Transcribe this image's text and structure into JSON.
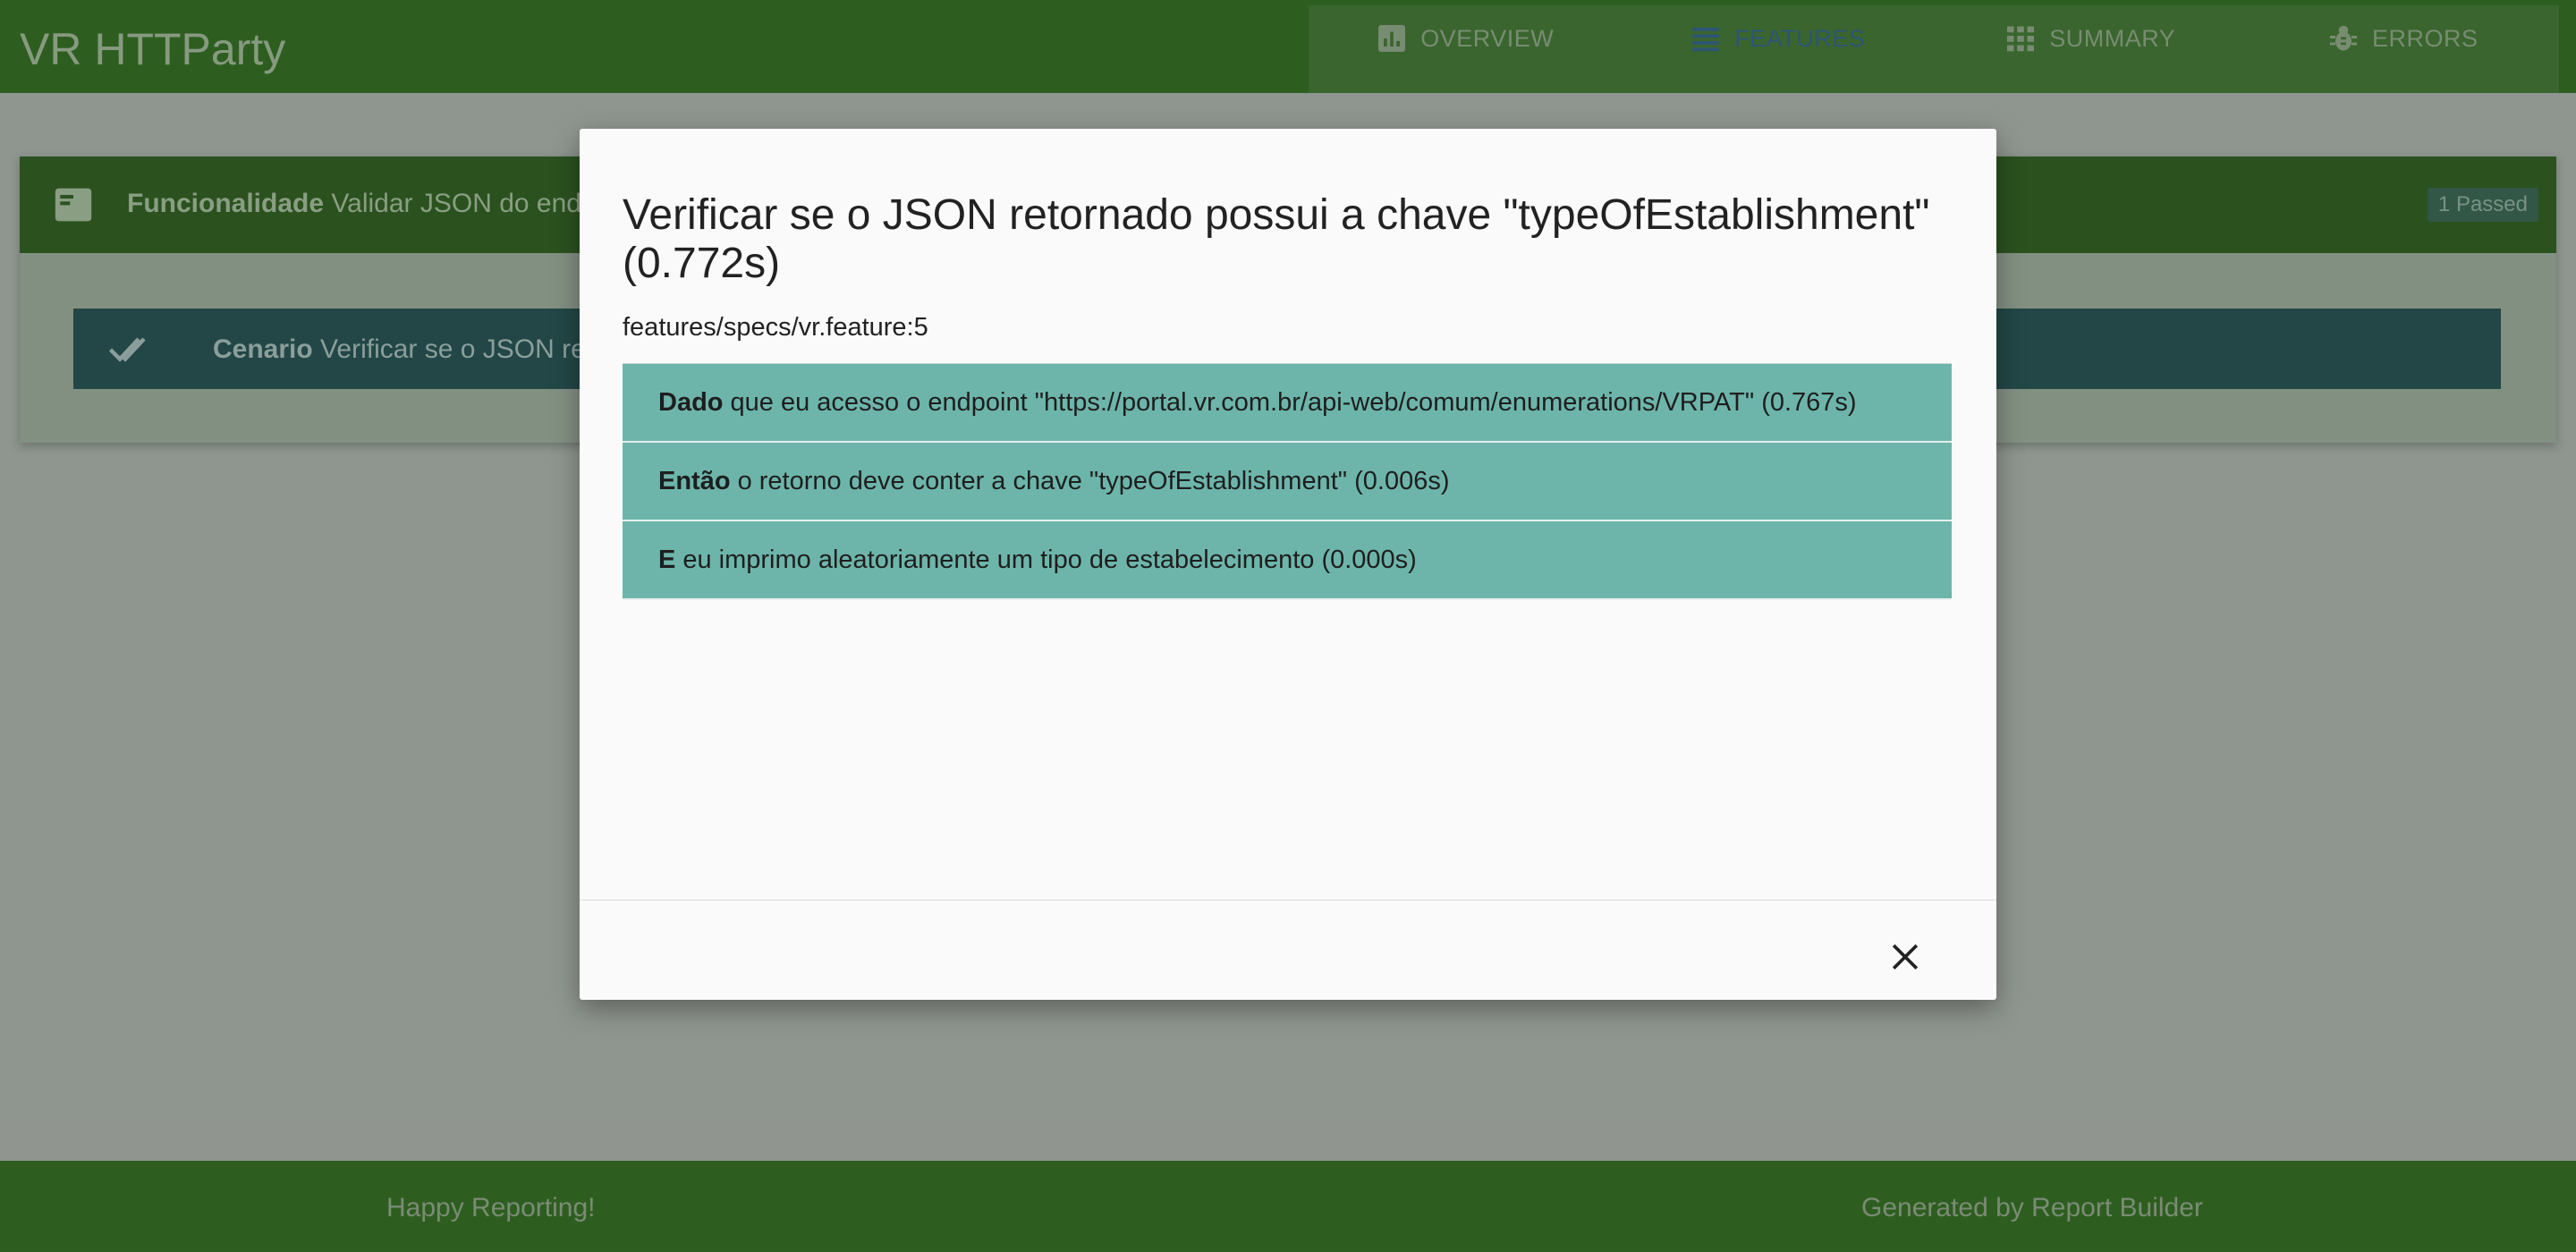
{
  "app": {
    "title": "VR HTTParty"
  },
  "nav": {
    "items": [
      {
        "label": "OVERVIEW",
        "icon": "bar-chart-icon",
        "active": false
      },
      {
        "label": "FEATURES",
        "icon": "list-icon",
        "active": true
      },
      {
        "label": "SUMMARY",
        "icon": "grid-icon",
        "active": false
      },
      {
        "label": "ERRORS",
        "icon": "bug-icon",
        "active": false
      }
    ]
  },
  "feature": {
    "keyword": "Funcionalidade",
    "name": "Validar JSON do endp",
    "badge": "1 Passed"
  },
  "scenario": {
    "keyword": "Cenario",
    "name": "Verificar se o JSON retorna"
  },
  "modal": {
    "title": "Verificar se o JSON retornado possui a chave \"typeOfEstablishment\" (0.772s)",
    "subtitle": "features/specs/vr.feature:5",
    "steps": [
      {
        "keyword": "Dado",
        "text": "que eu acesso o endpoint \"https://portal.vr.com.br/api-web/comum/enumerations/VRPAT\" (0.767s)"
      },
      {
        "keyword": "Então",
        "text": "o retorno deve conter a chave \"typeOfEstablishment\" (0.006s)"
      },
      {
        "keyword": "E",
        "text": "eu imprimo aleatoriamente um tipo de estabelecimento (0.000s)"
      }
    ],
    "close_icon": "close-icon"
  },
  "footer": {
    "left": "Happy Reporting!",
    "right": "Generated by Report Builder"
  },
  "colors": {
    "nav_bar": "#2f6a1f",
    "step_passed": "#6db5aa",
    "active_tab": "#2f5f86"
  }
}
